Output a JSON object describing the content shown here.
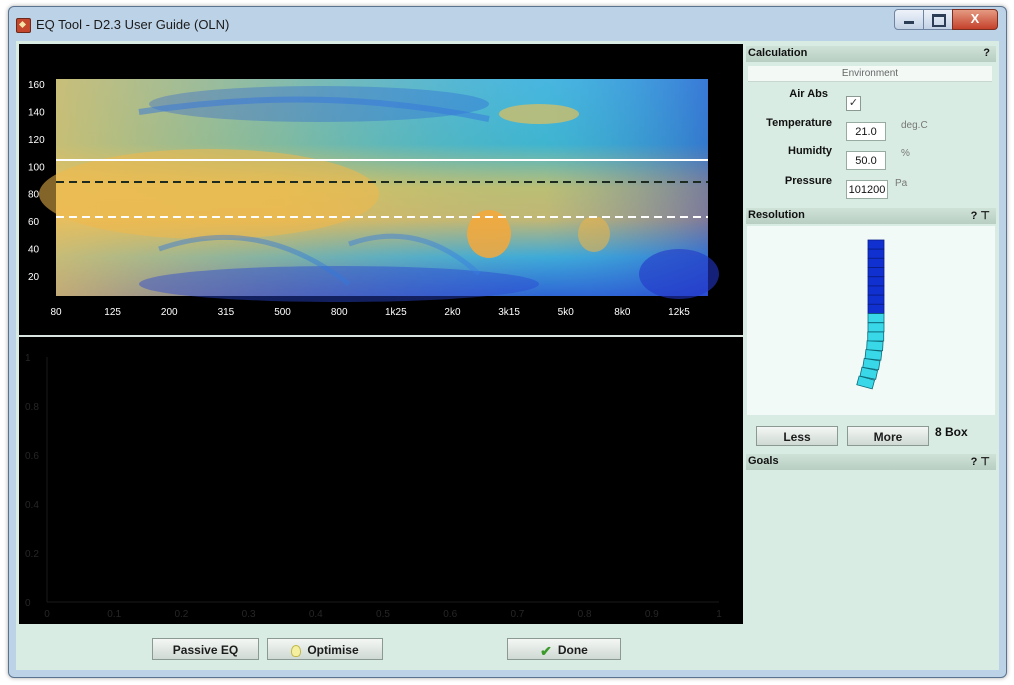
{
  "window": {
    "title": "EQ Tool - D2.3 User Guide (OLN)",
    "close_glyph": "X"
  },
  "spectrogram": {
    "y_ticks": [
      "160",
      "140",
      "120",
      "100",
      "80",
      "60",
      "40",
      "20"
    ],
    "x_ticks": [
      "80",
      "125",
      "200",
      "315",
      "500",
      "800",
      "1k25",
      "2k0",
      "3k15",
      "5k0",
      "8k0",
      "12k5"
    ]
  },
  "bottom_plot": {
    "y_ticks": [
      "1",
      "0.8",
      "0.6",
      "0.4",
      "0.2",
      "0"
    ],
    "x_ticks": [
      "0",
      "0.1",
      "0.2",
      "0.3",
      "0.4",
      "0.5",
      "0.6",
      "0.7",
      "0.8",
      "0.9",
      "1"
    ]
  },
  "buttons": {
    "passive_eq": "Passive EQ",
    "optimise": "Optimise",
    "done": "Done"
  },
  "calculation": {
    "header": "Calculation",
    "help": "?",
    "environment_label": "Environment",
    "air_abs_label": "Air Abs",
    "air_abs_check": "✓",
    "temperature_label": "Temperature",
    "temperature_value": "21.0",
    "temperature_unit": "deg.C",
    "humidity_label": "Humidty",
    "humidity_value": "50.0",
    "humidity_unit": "%",
    "pressure_label": "Pressure",
    "pressure_value": "101200",
    "pressure_unit": "Pa"
  },
  "resolution": {
    "header": "Resolution",
    "help": "?",
    "pin": "⊤",
    "less_label": "Less",
    "more_label": "More",
    "box_count": "8 Box"
  },
  "goals": {
    "header": "Goals",
    "help": "?",
    "pin": "⊤"
  },
  "colors": {
    "plot_bg": "#000000",
    "spec_low": "#2f3fd0",
    "spec_mid": "#2fb0d0",
    "spec_high": "#f3b34a",
    "panel_bg": "#d9ece3",
    "res_dark": "#1030d0",
    "res_light": "#38d8e8"
  }
}
